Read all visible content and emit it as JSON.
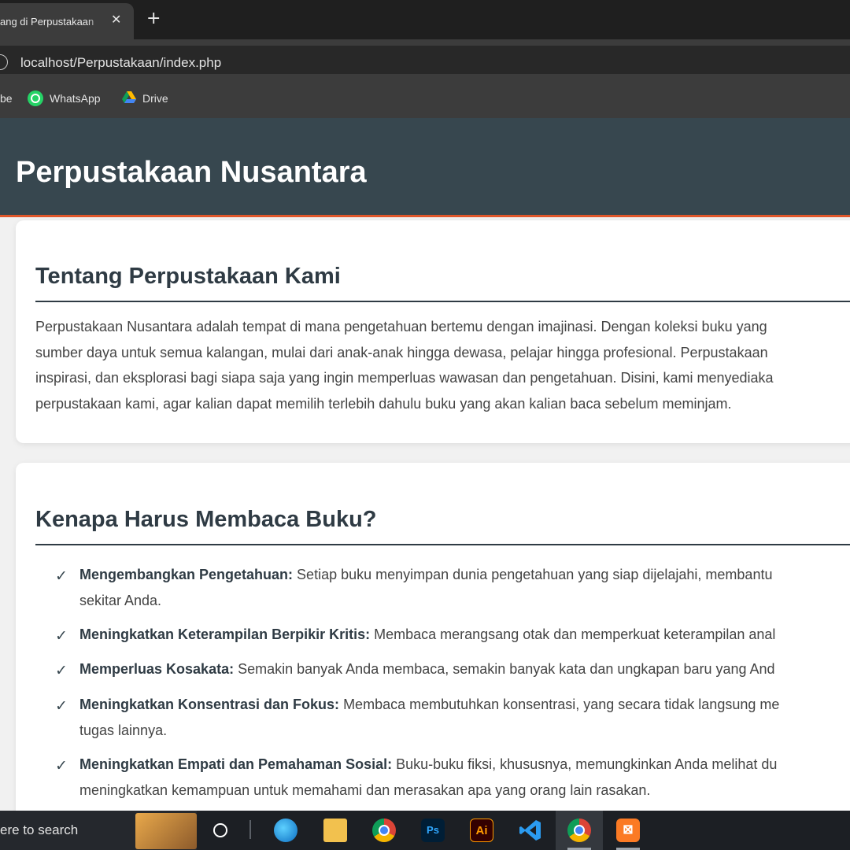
{
  "browser": {
    "tab_title": "ang di Perpustakaan",
    "tab_close": "✕",
    "new_tab": "+",
    "url": "localhost/Perpustakaan/index.php",
    "bookmarks": [
      {
        "label": "be"
      },
      {
        "label": "WhatsApp"
      },
      {
        "label": "Drive"
      }
    ]
  },
  "site": {
    "title": "Perpustakaan Nusantara",
    "header_bg": "#37474f",
    "accent": "#e0572a"
  },
  "about": {
    "heading": "Tentang Perpustakaan Kami",
    "lines": [
      "Perpustakaan Nusantara adalah tempat di mana pengetahuan bertemu dengan imajinasi. Dengan koleksi buku yang",
      "sumber daya untuk semua kalangan, mulai dari anak-anak hingga dewasa, pelajar hingga profesional. Perpustakaan",
      "inspirasi, dan eksplorasi bagi siapa saja yang ingin memperluas wawasan dan pengetahuan. Disini, kami menyediaka",
      "perpustakaan kami, agar kalian dapat memilih terlebih dahulu buku yang akan kalian baca sebelum meminjam."
    ]
  },
  "reasons": {
    "heading": "Kenapa Harus Membaca Buku?",
    "check": "✓",
    "items": [
      {
        "title": "Mengembangkan Pengetahuan:",
        "text": " Setiap buku menyimpan dunia pengetahuan yang siap dijelajahi, membantu",
        "cont": "sekitar Anda."
      },
      {
        "title": "Meningkatkan Keterampilan Berpikir Kritis:",
        "text": " Membaca merangsang otak dan memperkuat keterampilan anal",
        "cont": ""
      },
      {
        "title": "Memperluas Kosakata:",
        "text": " Semakin banyak Anda membaca, semakin banyak kata dan ungkapan baru yang And",
        "cont": ""
      },
      {
        "title": "Meningkatkan Konsentrasi dan Fokus:",
        "text": " Membaca membutuhkan konsentrasi, yang secara tidak langsung me",
        "cont": "tugas lainnya."
      },
      {
        "title": "Meningkatkan Empati dan Pemahaman Sosial:",
        "text": " Buku-buku fiksi, khususnya, memungkinkan Anda melihat du",
        "cont": "meningkatkan kemampuan untuk memahami dan merasakan apa yang orang lain rasakan."
      }
    ]
  },
  "taskbar": {
    "search_placeholder": "ere to search",
    "apps": [
      "edge-icon",
      "file-explorer-icon",
      "chrome-icon",
      "photoshop-icon",
      "illustrator-icon",
      "vscode-icon",
      "chrome-icon",
      "xampp-icon"
    ],
    "ps_label": "Ps",
    "ai_label": "Ai",
    "xampp_label": "⊠"
  }
}
